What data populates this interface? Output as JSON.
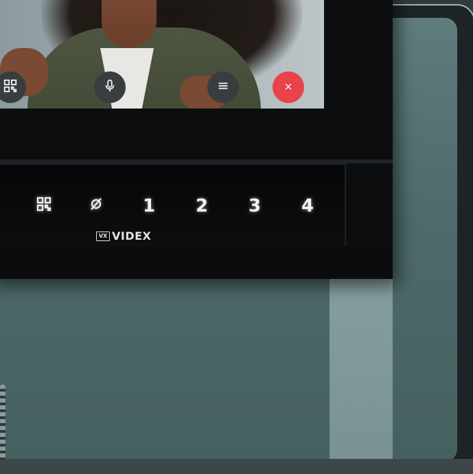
{
  "call_screen": {
    "buttons": [
      {
        "icon": "qr-code-icon"
      },
      {
        "icon": "microphone-icon"
      },
      {
        "icon": "settings-sliders-icon"
      },
      {
        "icon": "close-icon",
        "symbol": "×",
        "color": "#e8424a"
      }
    ]
  },
  "keypad": {
    "keys": [
      {
        "icon": "dot-icon"
      },
      {
        "icon": "qr-code-icon"
      },
      {
        "icon": "mute-icon",
        "symbol": "ø"
      },
      {
        "label": "1"
      },
      {
        "label": "2"
      },
      {
        "label": "3"
      },
      {
        "label": "4"
      }
    ]
  },
  "brand": {
    "logo_text": "VX",
    "name": "VIDEX"
  },
  "colors": {
    "background_teal": "#4e6a6a",
    "monitor_black": "#0b0d0e",
    "end_call_red": "#e8424a"
  }
}
